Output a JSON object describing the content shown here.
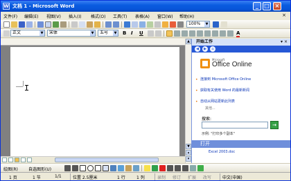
{
  "window": {
    "title": "文档 1 - Microsoft Word",
    "minimize": "_",
    "maximize": "□",
    "close": "×"
  },
  "menu": [
    "文件(F)",
    "编辑(E)",
    "视图(V)",
    "插入(I)",
    "格式(O)",
    "工具(T)",
    "表格(A)",
    "窗口(W)",
    "帮助(H)"
  ],
  "menu_doc_close": "×",
  "standard_toolbar": {
    "zoom": "100%",
    "read_label": ""
  },
  "format_toolbar": {
    "style": "正文",
    "font": "宋体",
    "size": "五号",
    "bold": "B",
    "italic": "I",
    "underline": "U",
    "font_color_label": "A"
  },
  "task_pane": {
    "title": "开始工作",
    "close": "▾ ×",
    "logo_small": "Microsoft",
    "logo": "Office Online",
    "links": [
      "连接到 Microsoft Office Online",
      "获取有关使用 Word 的最新新闻",
      "自动从网站更新此列表"
    ],
    "more": "其他...",
    "search_label": "搜索:",
    "go": "→",
    "example": "示例: \"打印多个副本\"",
    "open_section": "打开",
    "recent_file": "Excel 2003.doc"
  },
  "draw_toolbar": {
    "draw": "绘图(R)",
    "autoshapes": "自选图形(U)"
  },
  "status": {
    "page": "1 页",
    "section": "1 节",
    "page_of": "1/1",
    "position": "位置 2.5厘米",
    "line": "1 行",
    "column": "1 列",
    "rec": "录制",
    "trk": "修订",
    "ext": "扩展",
    "ovr": "改写",
    "lang": "中文(中国)"
  },
  "colors": {
    "title_blue": "#0a5ce0",
    "taskpane_nav": "#2658d6",
    "office_orange": "#f09010"
  }
}
